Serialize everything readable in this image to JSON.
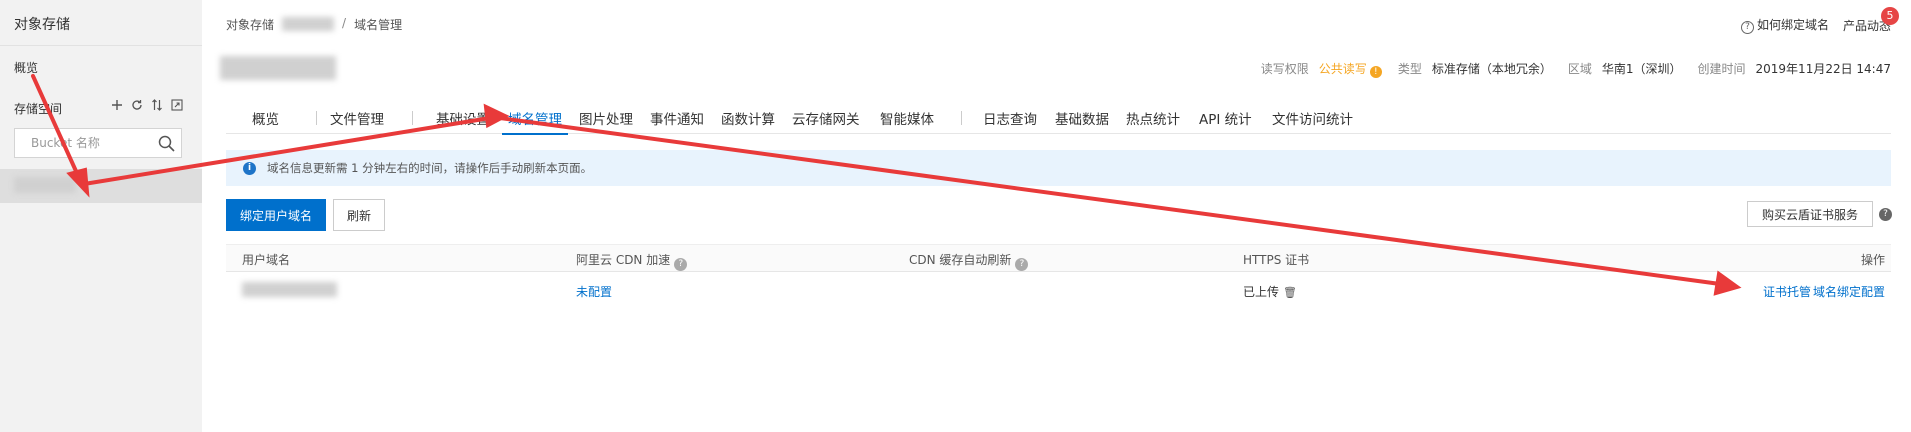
{
  "sidebar": {
    "title": "对象存储",
    "overview": "概览",
    "storage_label": "存储空间",
    "search_placeholder": "Bucket 名称"
  },
  "breadcrumb": [
    "对象存储",
    "/",
    "域名管理"
  ],
  "top_right": {
    "help": "如何绑定域名",
    "product_news": "产品动态",
    "badge": "5"
  },
  "meta": {
    "rw_label": "读写权限",
    "rw_value": "公共读写",
    "type_label": "类型",
    "type_value": "标准存储（本地冗余）",
    "region_label": "区域",
    "region_value": "华南1（深圳）",
    "created_label": "创建时间",
    "created_value": "2019年11月22日 14:47"
  },
  "tabs": [
    "概览",
    "文件管理",
    "基础设置",
    "域名管理",
    "图片处理",
    "事件通知",
    "函数计算",
    "云存储网关",
    "智能媒体",
    "日志查询",
    "基础数据",
    "热点统计",
    "API 统计",
    "文件访问统计"
  ],
  "active_tab": "域名管理",
  "notice": "域名信息更新需 1 分钟左右的时间，请操作后手动刷新本页面。",
  "buttons": {
    "bind": "绑定用户域名",
    "refresh": "刷新",
    "buy_cert": "购买云盾证书服务"
  },
  "table": {
    "headers": {
      "domain": "用户域名",
      "cdn": "阿里云 CDN 加速",
      "cdn_refresh": "CDN 缓存自动刷新",
      "https": "HTTPS 证书",
      "actions": "操作"
    },
    "rows": [
      {
        "domain": "",
        "cdn": "未配置",
        "https": "已上传",
        "action_cert": "证书托管",
        "action_bind": "域名绑定配置"
      }
    ]
  },
  "colors": {
    "primary": "#0070cc",
    "warning": "#f5a623",
    "annotation": "#e83a3a",
    "badge": "#e64545"
  }
}
